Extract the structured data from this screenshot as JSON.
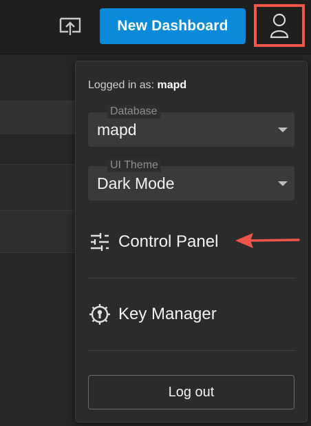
{
  "topbar": {
    "new_dashboard_label": "New Dashboard",
    "share_icon": "share-export-icon",
    "user_icon": "user-icon"
  },
  "menu": {
    "logged_in_prefix": "Logged in as:",
    "logged_in_user": "mapd",
    "database_label": "Database",
    "database_value": "mapd",
    "theme_label": "UI Theme",
    "theme_value": "Dark Mode",
    "control_panel_label": "Control Panel",
    "key_manager_label": "Key Manager",
    "logout_label": "Log out"
  },
  "colors": {
    "accent_button": "#0a8ad8",
    "highlight": "#f05547"
  }
}
